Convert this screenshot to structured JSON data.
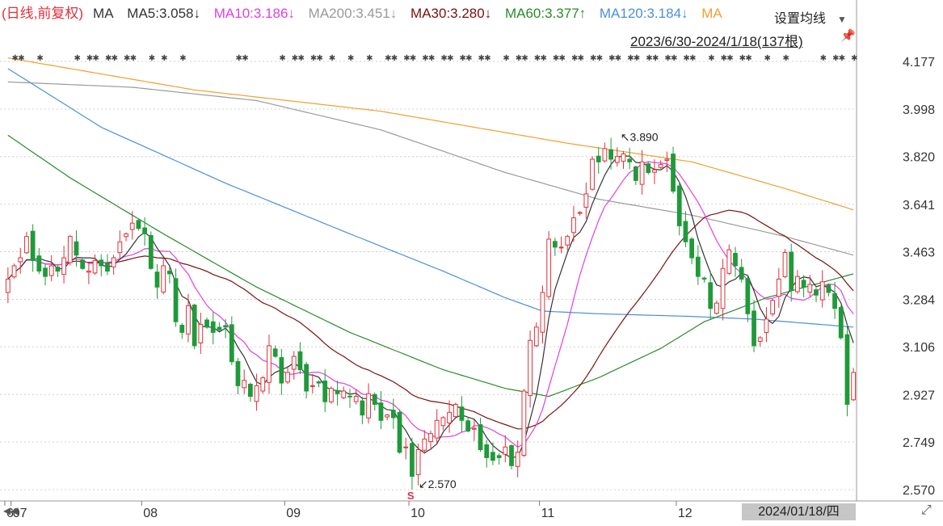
{
  "legend": {
    "mode": "(日线,前复权)",
    "ma_label": "MA",
    "items": [
      {
        "text": "MA5:3.058↓",
        "color": "#333333"
      },
      {
        "text": "MA10:3.186↓",
        "color": "#e040e0"
      },
      {
        "text": "MA200:3.451↓",
        "color": "#9a9a9a"
      },
      {
        "text": "MA30:3.280↓",
        "color": "#7a1010"
      },
      {
        "text": "MA60:3.377↑",
        "color": "#2a8a2a"
      },
      {
        "text": "MA120:3.184↓",
        "color": "#4a90d9"
      },
      {
        "text": "MA",
        "color": "#f0a030"
      }
    ]
  },
  "settings_label": "设置均线",
  "range_label": "2023/6/30-2024/1/18(137根)",
  "date_badge": "2024/01/18/四",
  "icons": {
    "settings_arrow": "triangle-down-icon",
    "pin": "pin-icon",
    "nav_left": "double-left-icon",
    "nav_right": "expand-icon"
  },
  "colors": {
    "up": "#e0303a",
    "down": "#1f9a3a",
    "grid": "#cfcfcf",
    "axis_text": "#333333"
  },
  "chart_data": {
    "type": "candlestick",
    "title": "",
    "period": "daily",
    "adjustment": "前复权",
    "ylim": [
      2.57,
      4.177
    ],
    "y_ticks": [
      4.177,
      3.998,
      3.82,
      3.641,
      3.463,
      3.284,
      3.106,
      2.927,
      2.749,
      2.57
    ],
    "y_tick_labels": [
      "4.177",
      "3.998",
      "3.820",
      "3.641",
      "3.463",
      "3.284",
      "3.106",
      "2.927",
      "2.749",
      "2.570"
    ],
    "x_month_labels": [
      {
        "label": "6",
        "bar": 0
      },
      {
        "label": "07",
        "bar": 1
      },
      {
        "label": "08",
        "bar": 22
      },
      {
        "label": "09",
        "bar": 45
      },
      {
        "label": "10",
        "bar": 65
      },
      {
        "label": "11",
        "bar": 86
      },
      {
        "label": "12",
        "bar": 108
      }
    ],
    "grid": true,
    "annotations": [
      {
        "text": "3.890",
        "bar": 98,
        "value": 3.89,
        "type": "high"
      },
      {
        "text": "2.570",
        "bar": 65,
        "value": 2.57,
        "type": "low"
      }
    ],
    "close": [
      3.36,
      3.41,
      3.44,
      3.52,
      3.43,
      3.39,
      3.37,
      3.41,
      3.39,
      3.44,
      3.52,
      3.45,
      3.4,
      3.39,
      3.43,
      3.41,
      3.39,
      3.44,
      3.5,
      3.53,
      3.57,
      3.55,
      3.53,
      3.4,
      3.33,
      3.41,
      3.38,
      3.2,
      3.16,
      3.26,
      3.11,
      3.19,
      3.18,
      3.16,
      3.17,
      3.18,
      3.05,
      2.96,
      2.98,
      2.92,
      2.96,
      2.99,
      3.11,
      3.07,
      2.97,
      3.01,
      3.07,
      3.02,
      2.94,
      2.96,
      2.97,
      2.9,
      2.95,
      2.93,
      2.94,
      2.92,
      2.92,
      2.85,
      2.93,
      2.89,
      2.83,
      2.85,
      2.84,
      2.71,
      2.73,
      2.62,
      2.72,
      2.76,
      2.78,
      2.83,
      2.84,
      2.86,
      2.89,
      2.83,
      2.79,
      2.8,
      2.72,
      2.69,
      2.68,
      2.69,
      2.73,
      2.66,
      2.71,
      2.94,
      3.13,
      3.18,
      3.31,
      3.51,
      3.48,
      3.48,
      3.52,
      3.59,
      3.61,
      3.68,
      3.81,
      3.8,
      3.85,
      3.81,
      3.82,
      3.83,
      3.8,
      3.73,
      3.8,
      3.76,
      3.77,
      3.79,
      3.81,
      3.69,
      3.56,
      3.5,
      3.44,
      3.37,
      3.36,
      3.25,
      3.27,
      3.4,
      3.47,
      3.41,
      3.36,
      3.23,
      3.11,
      3.14,
      3.21,
      3.28,
      3.36,
      3.46,
      3.32,
      3.37,
      3.33,
      3.34,
      3.3,
      3.35,
      3.31,
      3.25,
      3.14,
      2.89,
      3.01
    ],
    "series": [
      {
        "name": "MA5",
        "last": 3.058,
        "trend": "down",
        "color": "#333333"
      },
      {
        "name": "MA10",
        "last": 3.186,
        "trend": "down",
        "color": "#e040e0"
      },
      {
        "name": "MA30",
        "last": 3.28,
        "trend": "down",
        "color": "#7a1010"
      },
      {
        "name": "MA60",
        "last": 3.377,
        "trend": "up",
        "color": "#2a8a2a"
      },
      {
        "name": "MA120",
        "last": 3.184,
        "trend": "down",
        "color": "#4a90d9"
      },
      {
        "name": "MA200",
        "last": 3.451,
        "trend": "down",
        "color": "#9a9a9a"
      },
      {
        "name": "MA",
        "trend": "",
        "color": "#f0a030"
      }
    ],
    "long_ma_paths": {
      "MA60": {
        "bar": [
          0,
          10,
          25,
          40,
          55,
          70,
          80,
          87,
          95,
          105,
          112,
          122,
          136
        ],
        "value": [
          3.9,
          3.74,
          3.53,
          3.33,
          3.16,
          3.02,
          2.95,
          2.92,
          2.99,
          3.1,
          3.2,
          3.29,
          3.38
        ]
      },
      "MA120": {
        "bar": [
          0,
          15,
          35,
          55,
          70,
          80,
          86,
          95,
          110,
          120,
          136
        ],
        "value": [
          4.15,
          3.93,
          3.72,
          3.53,
          3.39,
          3.29,
          3.24,
          3.23,
          3.22,
          3.21,
          3.18
        ]
      },
      "MA200": {
        "bar": [
          0,
          20,
          40,
          60,
          80,
          95,
          110,
          125,
          136
        ],
        "value": [
          4.1,
          4.08,
          4.03,
          3.92,
          3.76,
          3.66,
          3.6,
          3.52,
          3.45
        ]
      },
      "MA": {
        "bar": [
          0,
          30,
          60,
          90,
          110,
          125,
          136
        ],
        "value": [
          4.19,
          4.07,
          3.99,
          3.87,
          3.8,
          3.7,
          3.62
        ]
      }
    }
  }
}
